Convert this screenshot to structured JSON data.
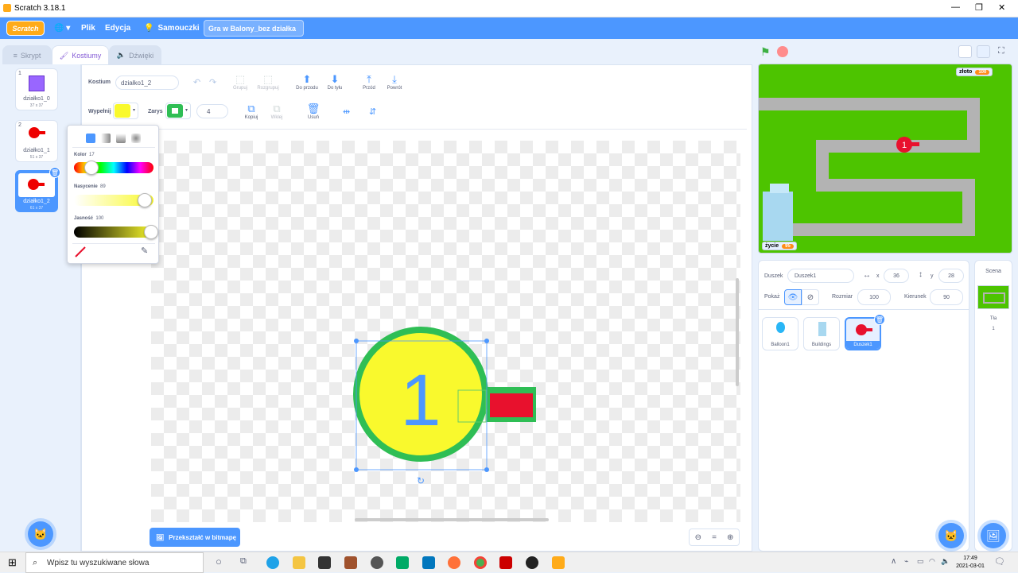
{
  "window": {
    "title": "Scratch 3.18.1",
    "minimize": "—",
    "maximize": "❐",
    "close": "✕"
  },
  "menubar": {
    "logo": "Scratch",
    "globe": "🌐 ▾",
    "file": "Plik",
    "edit": "Edycja",
    "tutorials": "Samouczki",
    "project_title": "Gra w Balony_bez działka"
  },
  "tabs": {
    "code": "Skrypt",
    "costumes": "Kostiumy",
    "sounds": "Dźwięki"
  },
  "costumes": [
    {
      "num": "1",
      "name": "działko1_0",
      "size": "37 x 37"
    },
    {
      "num": "2",
      "name": "działko1_1",
      "size": "51 x 37"
    },
    {
      "num": "3",
      "name": "działko1_2",
      "size": "61 x 37"
    }
  ],
  "editor": {
    "costume_label": "Kostium",
    "costume_name": "działko1_2",
    "fill_label": "Wypełnij",
    "outline_label": "Zarys",
    "outline_width": "4",
    "group": "Grupuj",
    "ungroup": "Rozgrupuj",
    "forward": "Do przodu",
    "backward": "Do tyłu",
    "front": "Przód",
    "back": "Powrót",
    "copy": "Kopiuj",
    "paste": "Wklej",
    "delete": "Usuń",
    "bitmap_button": "Przekształć w bitmapę",
    "canvas_number": "1",
    "zoom_reset": "="
  },
  "colorpicker": {
    "color_label": "Kolor",
    "color_value": "17",
    "saturation_label": "Nasycenie",
    "saturation_value": "89",
    "brightness_label": "Jasność",
    "brightness_value": "100"
  },
  "stage": {
    "monitor_gold_label": "złoto",
    "monitor_gold_value": "100",
    "monitor_life_label": "życie",
    "monitor_life_value": "95",
    "balloon_number": "1"
  },
  "sprite_info": {
    "sprite_label": "Duszek",
    "sprite_name": "Duszek1",
    "x_label": "x",
    "x_value": "36",
    "y_label": "y",
    "y_value": "28",
    "show_label": "Pokaż",
    "size_label": "Rozmiar",
    "size_value": "100",
    "direction_label": "Kierunek",
    "direction_value": "90"
  },
  "sprites": [
    {
      "name": "Balloon1"
    },
    {
      "name": "Buildings"
    },
    {
      "name": "Duszek1"
    }
  ],
  "stage_pane": {
    "label": "Scena",
    "backdrops_label": "Tła",
    "backdrops_count": "1"
  },
  "taskbar": {
    "search_placeholder": "Wpisz tu wyszukiwane słowa",
    "time": "17:49",
    "date": "2021-03-01"
  },
  "colors": {
    "accent": "#4c97ff",
    "fill": "#f9f92d",
    "outline": "#2fbe55",
    "stage_green": "#4dc400",
    "path_gray": "#b3b3b3"
  }
}
